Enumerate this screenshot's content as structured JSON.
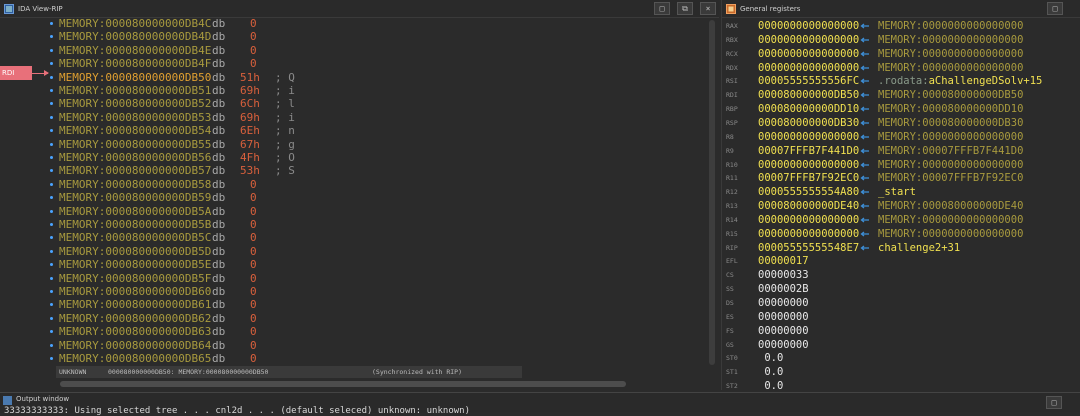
{
  "hex_view": {
    "title": "IDA View-RIP",
    "rdi_label": "RDI",
    "rows": [
      {
        "addr": "MEMORY:000080000000DB4C",
        "db": "db",
        "val": "0",
        "chr": "",
        "cur": false
      },
      {
        "addr": "MEMORY:000080000000DB4D",
        "db": "db",
        "val": "0",
        "chr": "",
        "cur": false
      },
      {
        "addr": "MEMORY:000080000000DB4E",
        "db": "db",
        "val": "0",
        "chr": "",
        "cur": false
      },
      {
        "addr": "MEMORY:000080000000DB4F",
        "db": "db",
        "val": "0",
        "chr": "",
        "cur": false
      },
      {
        "addr": "MEMORY:000080000000DB50",
        "db": "db",
        "val": "51h",
        "chr": "; Q",
        "cur": true
      },
      {
        "addr": "MEMORY:000080000000DB51",
        "db": "db",
        "val": "69h",
        "chr": "; i",
        "cur": false
      },
      {
        "addr": "MEMORY:000080000000DB52",
        "db": "db",
        "val": "6Ch",
        "chr": "; l",
        "cur": false
      },
      {
        "addr": "MEMORY:000080000000DB53",
        "db": "db",
        "val": "69h",
        "chr": "; i",
        "cur": false
      },
      {
        "addr": "MEMORY:000080000000DB54",
        "db": "db",
        "val": "6Eh",
        "chr": "; n",
        "cur": false
      },
      {
        "addr": "MEMORY:000080000000DB55",
        "db": "db",
        "val": "67h",
        "chr": "; g",
        "cur": false
      },
      {
        "addr": "MEMORY:000080000000DB56",
        "db": "db",
        "val": "4Fh",
        "chr": "; O",
        "cur": false
      },
      {
        "addr": "MEMORY:000080000000DB57",
        "db": "db",
        "val": "53h",
        "chr": "; S",
        "cur": false
      },
      {
        "addr": "MEMORY:000080000000DB58",
        "db": "db",
        "val": "0",
        "chr": "",
        "cur": false
      },
      {
        "addr": "MEMORY:000080000000DB59",
        "db": "db",
        "val": "0",
        "chr": "",
        "cur": false
      },
      {
        "addr": "MEMORY:000080000000DB5A",
        "db": "db",
        "val": "0",
        "chr": "",
        "cur": false
      },
      {
        "addr": "MEMORY:000080000000DB5B",
        "db": "db",
        "val": "0",
        "chr": "",
        "cur": false
      },
      {
        "addr": "MEMORY:000080000000DB5C",
        "db": "db",
        "val": "0",
        "chr": "",
        "cur": false
      },
      {
        "addr": "MEMORY:000080000000DB5D",
        "db": "db",
        "val": "0",
        "chr": "",
        "cur": false
      },
      {
        "addr": "MEMORY:000080000000DB5E",
        "db": "db",
        "val": "0",
        "chr": "",
        "cur": false
      },
      {
        "addr": "MEMORY:000080000000DB5F",
        "db": "db",
        "val": "0",
        "chr": "",
        "cur": false
      },
      {
        "addr": "MEMORY:000080000000DB60",
        "db": "db",
        "val": "0",
        "chr": "",
        "cur": false
      },
      {
        "addr": "MEMORY:000080000000DB61",
        "db": "db",
        "val": "0",
        "chr": "",
        "cur": false
      },
      {
        "addr": "MEMORY:000080000000DB62",
        "db": "db",
        "val": "0",
        "chr": "",
        "cur": false
      },
      {
        "addr": "MEMORY:000080000000DB63",
        "db": "db",
        "val": "0",
        "chr": "",
        "cur": false
      },
      {
        "addr": "MEMORY:000080000000DB64",
        "db": "db",
        "val": "0",
        "chr": "",
        "cur": false
      },
      {
        "addr": "MEMORY:000080000000DB65",
        "db": "db",
        "val": "0",
        "chr": "",
        "cur": false
      }
    ],
    "status": {
      "mode": "UNKNOWN",
      "location": "000080000000DB50: MEMORY:000080000000DB50",
      "sync": "(Synchronized with RIP)"
    }
  },
  "registers": {
    "title": "General registers",
    "rows": [
      {
        "name": "RAX",
        "value": "0000000000000000",
        "arrow": true,
        "target": "MEMORY:0000000000000000",
        "target_label": "",
        "style": ""
      },
      {
        "name": "RBX",
        "value": "0000000000000000",
        "arrow": true,
        "target": "MEMORY:0000000000000000",
        "target_label": "",
        "style": ""
      },
      {
        "name": "RCX",
        "value": "0000000000000000",
        "arrow": true,
        "target": "MEMORY:0000000000000000",
        "target_label": "",
        "style": ""
      },
      {
        "name": "RDX",
        "value": "0000000000000000",
        "arrow": true,
        "target": "MEMORY:0000000000000000",
        "target_label": "",
        "style": ""
      },
      {
        "name": "RSI",
        "value": "00005555555556FC",
        "arrow": true,
        "target": ".rodata:",
        "target_label": "aChallengeDSolv+15",
        "style": "rod"
      },
      {
        "name": "RDI",
        "value": "000080000000DB50",
        "arrow": true,
        "target": "MEMORY:000080000000DB50",
        "target_label": "",
        "style": ""
      },
      {
        "name": "RBP",
        "value": "000080000000DD10",
        "arrow": true,
        "target": "MEMORY:000080000000DD10",
        "target_label": "",
        "style": ""
      },
      {
        "name": "RSP",
        "value": "000080000000DB30",
        "arrow": true,
        "target": "MEMORY:000080000000DB30",
        "target_label": "",
        "style": ""
      },
      {
        "name": "R8",
        "value": "0000000000000000",
        "arrow": true,
        "target": "MEMORY:0000000000000000",
        "target_label": "",
        "style": ""
      },
      {
        "name": "R9",
        "value": "00007FFFB7F441D0",
        "arrow": true,
        "target": "MEMORY:00007FFFB7F441D0",
        "target_label": "",
        "style": ""
      },
      {
        "name": "R10",
        "value": "0000000000000000",
        "arrow": true,
        "target": "MEMORY:0000000000000000",
        "target_label": "",
        "style": ""
      },
      {
        "name": "R11",
        "value": "00007FFFB7F92EC0",
        "arrow": true,
        "target": "MEMORY:00007FFFB7F92EC0",
        "target_label": "",
        "style": ""
      },
      {
        "name": "R12",
        "value": "0000555555554A80",
        "arrow": true,
        "target": "_start",
        "target_label": "",
        "style": "y"
      },
      {
        "name": "R13",
        "value": "000080000000DE40",
        "arrow": true,
        "target": "MEMORY:000080000000DE40",
        "target_label": "",
        "style": ""
      },
      {
        "name": "R14",
        "value": "0000000000000000",
        "arrow": true,
        "target": "MEMORY:0000000000000000",
        "target_label": "",
        "style": ""
      },
      {
        "name": "R15",
        "value": "0000000000000000",
        "arrow": true,
        "target": "MEMORY:0000000000000000",
        "target_label": "",
        "style": ""
      },
      {
        "name": "RIP",
        "value": "00005555555548E7",
        "arrow": true,
        "target": "challenge2+31",
        "target_label": "",
        "style": "y"
      },
      {
        "name": "EFL",
        "value": "00000017",
        "arrow": false,
        "target": "",
        "target_label": "",
        "style": "yv"
      },
      {
        "name": "CS",
        "value": "00000033",
        "arrow": false,
        "target": "",
        "target_label": "",
        "style": "w"
      },
      {
        "name": "SS",
        "value": "0000002B",
        "arrow": false,
        "target": "",
        "target_label": "",
        "style": "w"
      },
      {
        "name": "DS",
        "value": "00000000",
        "arrow": false,
        "target": "",
        "target_label": "",
        "style": "w"
      },
      {
        "name": "ES",
        "value": "00000000",
        "arrow": false,
        "target": "",
        "target_label": "",
        "style": "w"
      },
      {
        "name": "FS",
        "value": "00000000",
        "arrow": false,
        "target": "",
        "target_label": "",
        "style": "w"
      },
      {
        "name": "GS",
        "value": "00000000",
        "arrow": false,
        "target": "",
        "target_label": "",
        "style": "w"
      },
      {
        "name": "ST0",
        "value": " 0.0",
        "arrow": false,
        "target": "",
        "target_label": "",
        "style": "w"
      },
      {
        "name": "ST1",
        "value": " 0.0",
        "arrow": false,
        "target": "",
        "target_label": "",
        "style": "w"
      },
      {
        "name": "ST2",
        "value": " 0.0",
        "arrow": false,
        "target": "",
        "target_label": "",
        "style": "w"
      }
    ]
  },
  "output": {
    "title": "Output window",
    "partial_text": "33333333333: Using selected tree . . . cnl2d . . . (default seleced) unknown: unknown)"
  },
  "colors": {
    "accent_rdi": "#e8707a",
    "address": "#a89a3e",
    "value": "#d9603c",
    "register": "#f0e050",
    "arrow": "#3d8fd8"
  }
}
